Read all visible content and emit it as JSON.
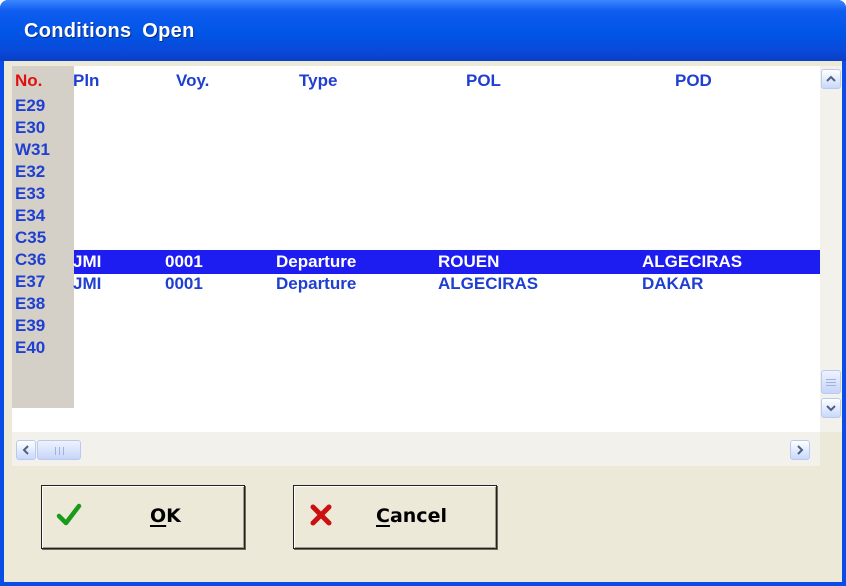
{
  "window": {
    "title": "Conditions  Open"
  },
  "table": {
    "headers": {
      "no": "No.",
      "pln": "Pln",
      "voy": "Voy.",
      "type": "Type",
      "pol": "POL",
      "pod": "POD"
    },
    "rows": [
      {
        "no": "E29"
      },
      {
        "no": "E30"
      },
      {
        "no": "W31"
      },
      {
        "no": "E32"
      },
      {
        "no": "E33"
      },
      {
        "no": "E34"
      },
      {
        "no": "C35",
        "pln": "JMI",
        "voy": "0001",
        "type": "Departure",
        "pol": "ROUEN",
        "pod": "ALGECIRAS",
        "selected": true
      },
      {
        "no": "C36",
        "pln": "JMI",
        "voy": "0001",
        "type": "Departure",
        "pol": "ALGECIRAS",
        "pod": "DAKAR"
      },
      {
        "no": "E37"
      },
      {
        "no": "E38"
      },
      {
        "no": "E39"
      },
      {
        "no": "E40"
      }
    ]
  },
  "buttons": {
    "ok": {
      "label": "OK",
      "icon": "check-icon"
    },
    "cancel": {
      "label": "Cancel",
      "icon": "x-icon"
    }
  },
  "colors": {
    "title_bar": "#0055e6",
    "header_no": "#e01010",
    "text": "#1f3fd0",
    "selection": "#1d1df2",
    "ok_check": "#1a9a1a",
    "cancel_x": "#cc1010"
  }
}
